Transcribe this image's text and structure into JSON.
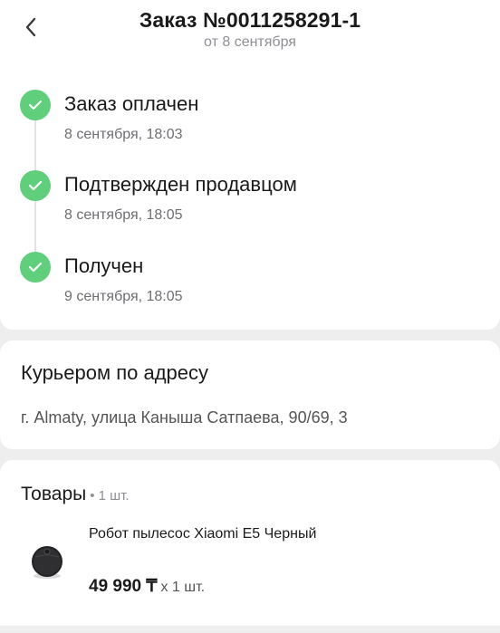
{
  "header": {
    "title": "Заказ №0011258291-1",
    "subtitle": "от 8 сентября"
  },
  "status_steps": [
    {
      "title": "Заказ оплачен",
      "time": "8 сентября, 18:03"
    },
    {
      "title": "Подтвержден продавцом",
      "time": "8 сентября, 18:05"
    },
    {
      "title": "Получен",
      "time": "9 сентября, 18:05"
    }
  ],
  "delivery": {
    "title": "Курьером по адресу",
    "address": "г. Almaty, улица Каныша Сатпаева, 90/69, 3"
  },
  "goods": {
    "title": "Товары",
    "count": "• 1 шт.",
    "items": [
      {
        "name": "Робот пылесос Xiaomi E5 Черный",
        "price": "49 990 ₸",
        "qty": "x 1 шт."
      }
    ]
  },
  "colors": {
    "success": "#5fcf7c",
    "background": "#eeeeef",
    "card": "#ffffff",
    "muted": "#8e8e93"
  },
  "icons": {
    "back": "chevron-left-icon",
    "status": "check-icon"
  }
}
